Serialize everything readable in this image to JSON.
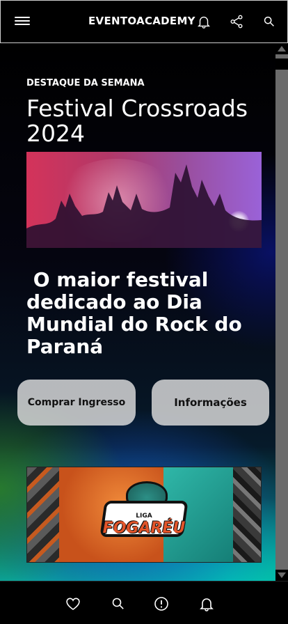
{
  "header": {
    "title": "EVENTOACADEMY",
    "icons": [
      "menu-icon",
      "bell-icon",
      "share-icon",
      "search-icon"
    ]
  },
  "featured": {
    "eyebrow": "DESTAQUE DA SEMANA",
    "title": "Festival Crossroads 2024",
    "subtitle": " O maior festival dedicado ao Dia Mundial do Rock do Paraná"
  },
  "actions": {
    "buy_label": "Comprar Ingresso",
    "info_label": "Informações"
  },
  "banner": {
    "liga": "LIGA",
    "name": "FOGARÉU"
  },
  "bottom_nav": {
    "icons": [
      "heart-icon",
      "search-icon",
      "info-icon",
      "bell-icon"
    ]
  },
  "colors": {
    "background": "#000000",
    "button_bg": "#dedede",
    "accent_orange": "#e2552a",
    "accent_teal": "#2fb7a8"
  }
}
